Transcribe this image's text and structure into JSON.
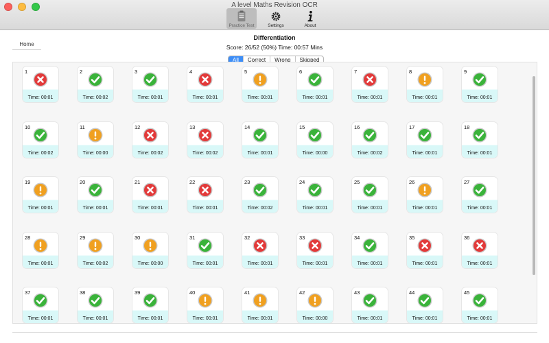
{
  "window": {
    "title": "A level Maths Revision OCR"
  },
  "toolbar": {
    "items": [
      {
        "label": "Practice Test",
        "icon": "practice-test-icon",
        "active": true
      },
      {
        "label": "Settings",
        "icon": "gear-icon",
        "active": false
      },
      {
        "label": "About",
        "icon": "info-icon",
        "active": false
      }
    ]
  },
  "nav": {
    "home_label": "Home"
  },
  "header": {
    "title": "Differentiation",
    "score": "Score: 26/52 (50%) Time: 00:57 Mins"
  },
  "filter": {
    "options": [
      "All",
      "Correct",
      "Wrong",
      "Skipped"
    ],
    "selected": "All"
  },
  "colors": {
    "correct": "#3ab33a",
    "wrong": "#e23a3a",
    "skipped": "#f0a020",
    "accent": "#3d8ef7"
  },
  "questions": [
    {
      "n": "1",
      "status": "wrong",
      "time": "Time: 00:01"
    },
    {
      "n": "2",
      "status": "correct",
      "time": "Time: 00:02"
    },
    {
      "n": "3",
      "status": "correct",
      "time": "Time: 00:01"
    },
    {
      "n": "4",
      "status": "wrong",
      "time": "Time: 00:01"
    },
    {
      "n": "5",
      "status": "skipped",
      "time": "Time: 00:01"
    },
    {
      "n": "6",
      "status": "correct",
      "time": "Time: 00:01"
    },
    {
      "n": "7",
      "status": "wrong",
      "time": "Time: 00:01"
    },
    {
      "n": "8",
      "status": "skipped",
      "time": "Time: 00:01"
    },
    {
      "n": "9",
      "status": "correct",
      "time": "Time: 00:01"
    },
    {
      "n": "10",
      "status": "correct",
      "time": "Time: 00:02"
    },
    {
      "n": "11",
      "status": "skipped",
      "time": "Time: 00:00"
    },
    {
      "n": "12",
      "status": "wrong",
      "time": "Time: 00:02"
    },
    {
      "n": "13",
      "status": "wrong",
      "time": "Time: 00:02"
    },
    {
      "n": "14",
      "status": "correct",
      "time": "Time: 00:01"
    },
    {
      "n": "15",
      "status": "correct",
      "time": "Time: 00:00"
    },
    {
      "n": "16",
      "status": "correct",
      "time": "Time: 00:02"
    },
    {
      "n": "17",
      "status": "correct",
      "time": "Time: 00:01"
    },
    {
      "n": "18",
      "status": "correct",
      "time": "Time: 00:01"
    },
    {
      "n": "19",
      "status": "skipped",
      "time": "Time: 00:01"
    },
    {
      "n": "20",
      "status": "correct",
      "time": "Time: 00:01"
    },
    {
      "n": "21",
      "status": "wrong",
      "time": "Time: 00:01"
    },
    {
      "n": "22",
      "status": "wrong",
      "time": "Time: 00:01"
    },
    {
      "n": "23",
      "status": "correct",
      "time": "Time: 00:02"
    },
    {
      "n": "24",
      "status": "correct",
      "time": "Time: 00:01"
    },
    {
      "n": "25",
      "status": "correct",
      "time": "Time: 00:01"
    },
    {
      "n": "26",
      "status": "skipped",
      "time": "Time: 00:01"
    },
    {
      "n": "27",
      "status": "correct",
      "time": "Time: 00:01"
    },
    {
      "n": "28",
      "status": "skipped",
      "time": "Time: 00:01"
    },
    {
      "n": "29",
      "status": "skipped",
      "time": "Time: 00:02"
    },
    {
      "n": "30",
      "status": "skipped",
      "time": "Time: 00:00"
    },
    {
      "n": "31",
      "status": "correct",
      "time": "Time: 00:01"
    },
    {
      "n": "32",
      "status": "wrong",
      "time": "Time: 00:01"
    },
    {
      "n": "33",
      "status": "wrong",
      "time": "Time: 00:01"
    },
    {
      "n": "34",
      "status": "correct",
      "time": "Time: 00:01"
    },
    {
      "n": "35",
      "status": "wrong",
      "time": "Time: 00:01"
    },
    {
      "n": "36",
      "status": "wrong",
      "time": "Time: 00:01"
    },
    {
      "n": "37",
      "status": "correct",
      "time": "Time: 00:01"
    },
    {
      "n": "38",
      "status": "correct",
      "time": "Time: 00:01"
    },
    {
      "n": "39",
      "status": "correct",
      "time": "Time: 00:01"
    },
    {
      "n": "40",
      "status": "skipped",
      "time": "Time: 00:01"
    },
    {
      "n": "41",
      "status": "skipped",
      "time": "Time: 00:01"
    },
    {
      "n": "42",
      "status": "skipped",
      "time": "Time: 00:00"
    },
    {
      "n": "43",
      "status": "correct",
      "time": "Time: 00:01"
    },
    {
      "n": "44",
      "status": "correct",
      "time": "Time: 00:01"
    },
    {
      "n": "45",
      "status": "correct",
      "time": "Time: 00:01"
    }
  ]
}
